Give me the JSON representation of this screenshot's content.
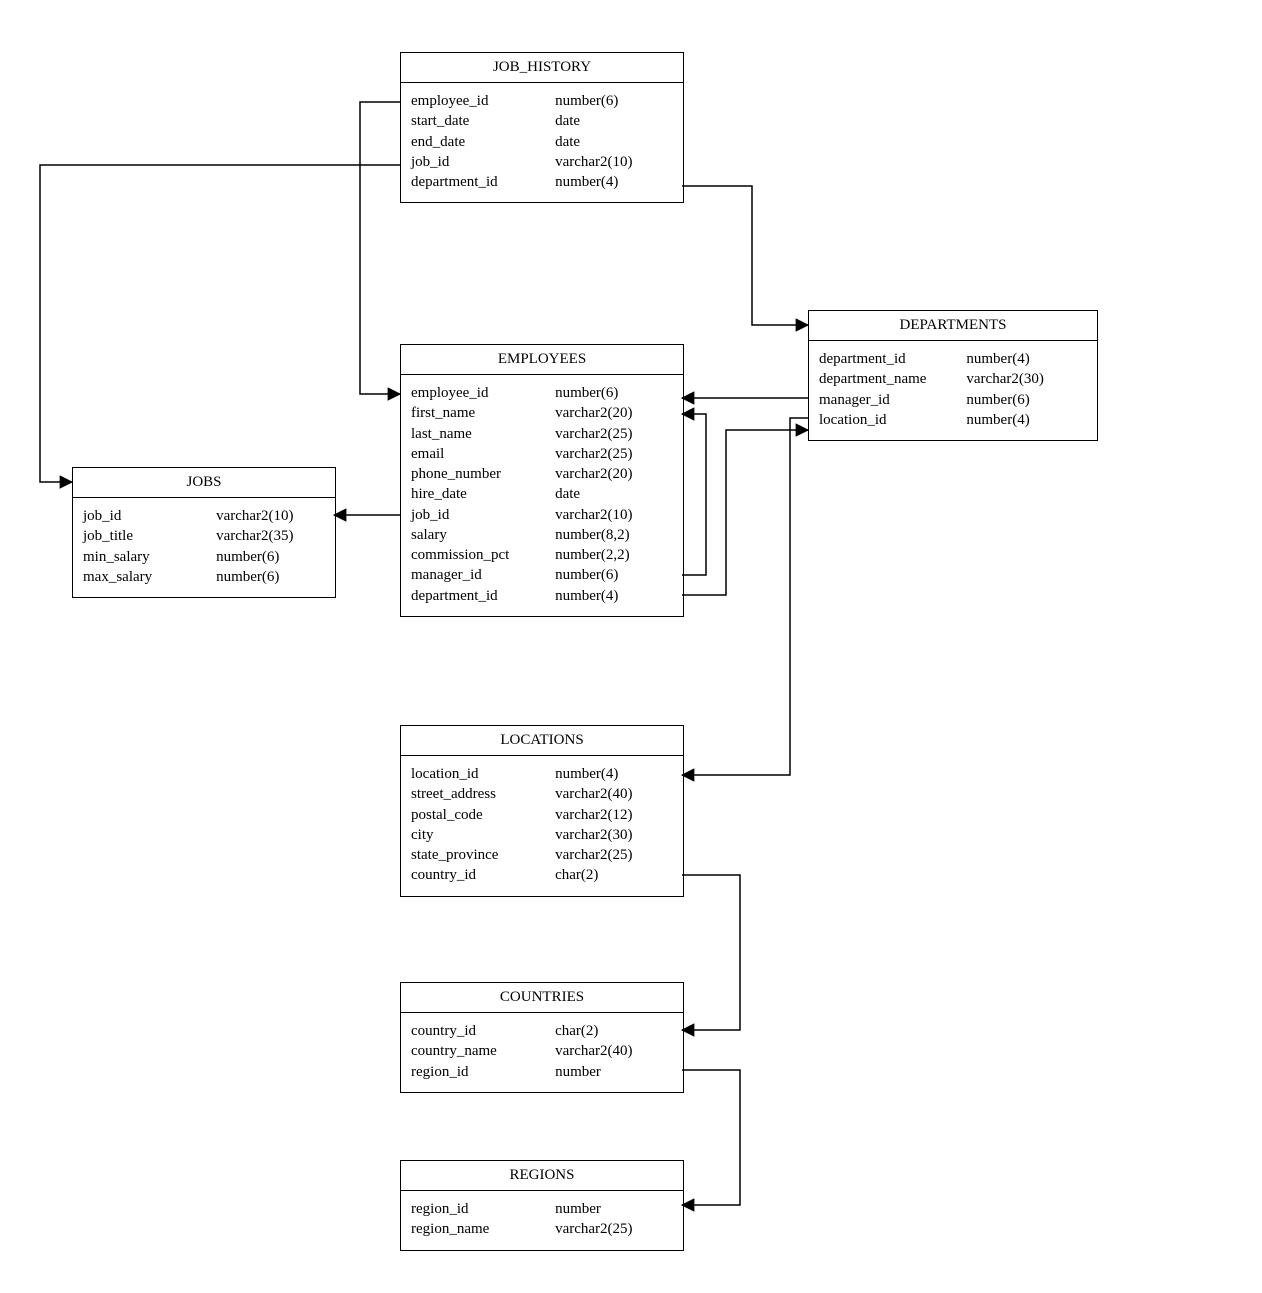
{
  "entities": {
    "job_history": {
      "title": "JOB_HISTORY",
      "fields": [
        {
          "name": "employee_id",
          "type": "number(6)"
        },
        {
          "name": "start_date",
          "type": "date"
        },
        {
          "name": "end_date",
          "type": "date"
        },
        {
          "name": "job_id",
          "type": "varchar2(10)"
        },
        {
          "name": "department_id",
          "type": "number(4)"
        }
      ]
    },
    "employees": {
      "title": "EMPLOYEES",
      "fields": [
        {
          "name": "employee_id",
          "type": "number(6)"
        },
        {
          "name": "first_name",
          "type": "varchar2(20)"
        },
        {
          "name": "last_name",
          "type": "varchar2(25)"
        },
        {
          "name": "email",
          "type": "varchar2(25)"
        },
        {
          "name": "phone_number",
          "type": "varchar2(20)"
        },
        {
          "name": "hire_date",
          "type": "date"
        },
        {
          "name": "job_id",
          "type": "varchar2(10)"
        },
        {
          "name": "salary",
          "type": "number(8,2)"
        },
        {
          "name": "commission_pct",
          "type": "number(2,2)"
        },
        {
          "name": "manager_id",
          "type": "number(6)"
        },
        {
          "name": "department_id",
          "type": "number(4)"
        }
      ]
    },
    "jobs": {
      "title": "JOBS",
      "fields": [
        {
          "name": "job_id",
          "type": "varchar2(10)"
        },
        {
          "name": "job_title",
          "type": "varchar2(35)"
        },
        {
          "name": "min_salary",
          "type": "number(6)"
        },
        {
          "name": "max_salary",
          "type": "number(6)"
        }
      ]
    },
    "departments": {
      "title": "DEPARTMENTS",
      "fields": [
        {
          "name": "department_id",
          "type": "number(4)"
        },
        {
          "name": "department_name",
          "type": "varchar2(30)"
        },
        {
          "name": "manager_id",
          "type": "number(6)"
        },
        {
          "name": "location_id",
          "type": "number(4)"
        }
      ]
    },
    "locations": {
      "title": "LOCATIONS",
      "fields": [
        {
          "name": "location_id",
          "type": "number(4)"
        },
        {
          "name": "street_address",
          "type": "varchar2(40)"
        },
        {
          "name": "postal_code",
          "type": "varchar2(12)"
        },
        {
          "name": "city",
          "type": "varchar2(30)"
        },
        {
          "name": "state_province",
          "type": "varchar2(25)"
        },
        {
          "name": "country_id",
          "type": "char(2)"
        }
      ]
    },
    "countries": {
      "title": "COUNTRIES",
      "fields": [
        {
          "name": "country_id",
          "type": "char(2)"
        },
        {
          "name": "country_name",
          "type": "varchar2(40)"
        },
        {
          "name": "region_id",
          "type": "number"
        }
      ]
    },
    "regions": {
      "title": "REGIONS",
      "fields": [
        {
          "name": "region_id",
          "type": "number"
        },
        {
          "name": "region_name",
          "type": "varchar2(25)"
        }
      ]
    }
  },
  "relationships": [
    {
      "from": "job_history.employee_id",
      "to": "employees.employee_id"
    },
    {
      "from": "job_history.job_id",
      "to": "jobs.job_id"
    },
    {
      "from": "job_history.department_id",
      "to": "departments.department_id"
    },
    {
      "from": "employees.job_id",
      "to": "jobs.job_id"
    },
    {
      "from": "employees.manager_id",
      "to": "employees.employee_id"
    },
    {
      "from": "employees.department_id",
      "to": "departments.department_id"
    },
    {
      "from": "departments.manager_id",
      "to": "employees.employee_id"
    },
    {
      "from": "departments.location_id",
      "to": "locations.location_id"
    },
    {
      "from": "locations.country_id",
      "to": "countries.country_id"
    },
    {
      "from": "countries.region_id",
      "to": "regions.region_id"
    }
  ]
}
